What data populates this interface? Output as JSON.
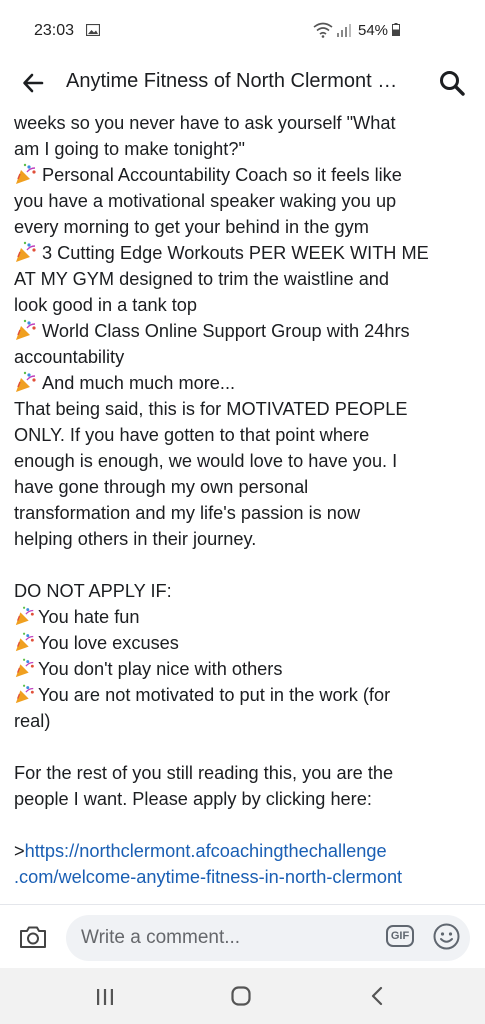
{
  "status_bar": {
    "time": "23:03",
    "battery": "54%",
    "icons": [
      "gallery-icon",
      "wifi-icon",
      "signal-icon",
      "battery-icon"
    ]
  },
  "header": {
    "title": "Anytime Fitness of North Clermont Group",
    "icons": [
      "back-arrow-icon",
      "search-icon"
    ]
  },
  "post": {
    "lines": [
      "weeks so you never have to ask yourself \"What",
      "am I going to make tonight?\"",
      "Personal Accountability Coach so it feels like",
      "you have a motivational speaker waking you up",
      "every morning to get your behind in the gym",
      "3 Cutting Edge Workouts PER WEEK WITH ME",
      "AT MY GYM designed to trim the waistline and",
      "look good in a tank top",
      "World Class Online Support Group with 24hrs",
      "accountability",
      "And much much more...",
      "That being said, this is for MOTIVATED PEOPLE",
      "ONLY. If you have gotten to that point where",
      "enough is enough, we would love to have you.  I",
      "have gone through my own personal",
      "transformation and my life's passion is now",
      "helping others in their journey.",
      "DO NOT APPLY IF:",
      "You hate fun",
      "You love excuses",
      "You don't play nice with others",
      "You are not motivated to put in the work (for",
      "real)",
      "For the rest of you still reading this, you are the",
      "people I want. Please apply by clicking here:",
      ">",
      "https://northclermont.afcoachingthechallenge",
      ".com/welcome-anytime-fitness-in-north-clermont"
    ],
    "bullet_icon": "party-popper-icon"
  },
  "comment_bar": {
    "placeholder": "Write a comment...",
    "gif_label": "GIF",
    "icons": [
      "camera-icon",
      "gif-icon",
      "emoji-icon"
    ]
  },
  "nav_bar": {
    "icons": [
      "recents-icon",
      "home-icon",
      "back-icon"
    ]
  },
  "colors": {
    "link": "#1a5fb4",
    "text": "#1c1e21",
    "comment_bg": "#f0f2f5",
    "nav_bg": "#f2f2f2"
  }
}
